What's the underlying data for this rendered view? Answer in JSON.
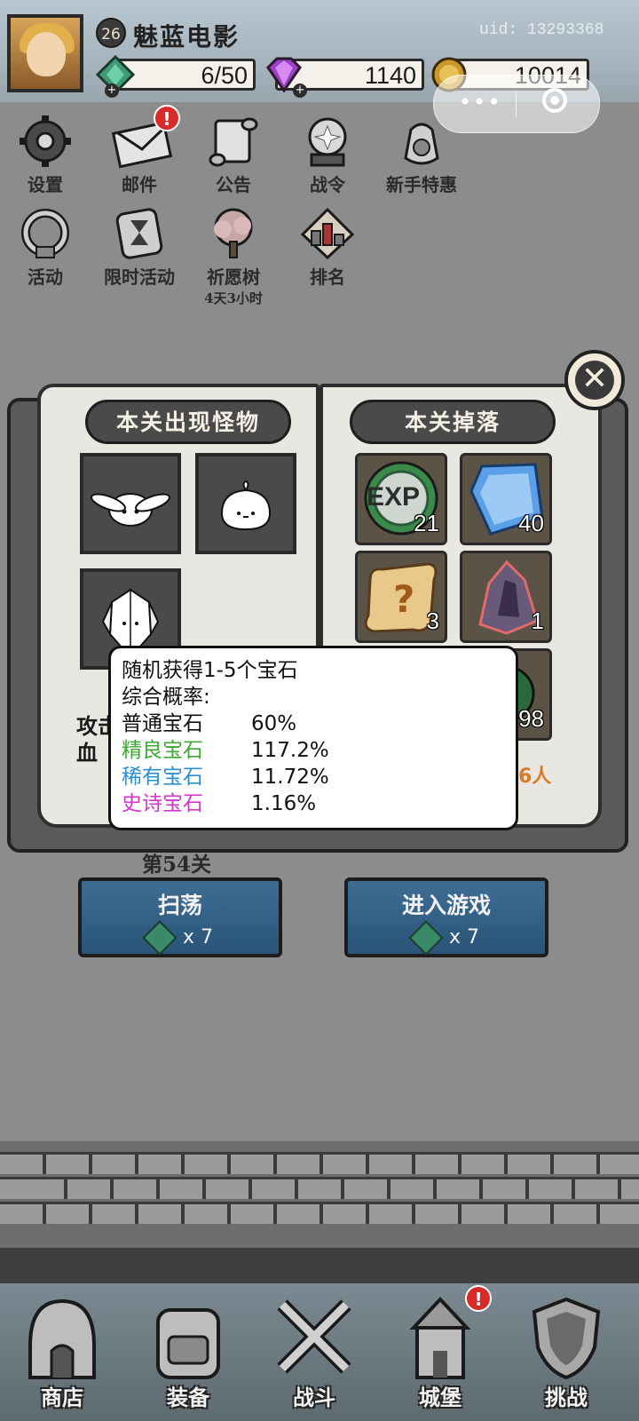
{
  "player": {
    "level": "26",
    "name": "魅蓝电影",
    "uid": "uid: 13293368"
  },
  "resources": {
    "stamina": "6/50",
    "diamonds": "1140",
    "coins": "10014"
  },
  "menu": [
    {
      "label": "设置",
      "icon": "gear-icon"
    },
    {
      "label": "邮件",
      "icon": "mail-icon",
      "badge": "!"
    },
    {
      "label": "公告",
      "icon": "scroll-icon"
    },
    {
      "label": "战令",
      "icon": "crystal-ball-icon"
    },
    {
      "label": "新手特惠",
      "icon": "money-bag-icon"
    },
    {
      "label": "活动",
      "icon": "wreath-icon"
    },
    {
      "label": "限时活动",
      "icon": "hourglass-icon"
    },
    {
      "label": "祈愿树",
      "icon": "tree-icon",
      "sub": "4天3小时"
    },
    {
      "label": "排名",
      "icon": "ranking-board-icon"
    }
  ],
  "modal": {
    "monsters_title": "本关出现怪物",
    "drops_title": "本关掉落",
    "monsters": [
      "rabbit-monster-icon",
      "dumpling-monster-icon",
      "crystal-golem-icon"
    ],
    "drops": [
      {
        "icon": "exp-icon",
        "exp_label": "EXP",
        "count": "21"
      },
      {
        "icon": "blue-gem-icon",
        "count": "40"
      },
      {
        "icon": "mystery-scroll-icon",
        "count": "3"
      },
      {
        "icon": "dark-crystal-icon",
        "count": "1"
      },
      {
        "icon": "green-orb-icon",
        "count": "98"
      }
    ],
    "stat_attack": "攻击",
    "stat_hp": "血",
    "players_suffix": "6人"
  },
  "tooltip": {
    "line1": "随机获得1-5个宝石",
    "line2": "综合概率:",
    "rows": [
      {
        "name": "普通宝石",
        "pct": "60%",
        "color": "#111111"
      },
      {
        "name": "精良宝石",
        "pct": "117.2%",
        "color": "#3fa835"
      },
      {
        "name": "稀有宝石",
        "pct": "11.72%",
        "color": "#2a8fd4"
      },
      {
        "name": "史诗宝石",
        "pct": "1.16%",
        "color": "#d436c8"
      }
    ]
  },
  "stage": {
    "label": "第54关",
    "sweep": {
      "label": "扫荡",
      "cost": "x 7"
    },
    "enter": {
      "label": "进入游戏",
      "cost": "x 7"
    }
  },
  "nav": [
    {
      "label": "商店",
      "icon": "shop-icon"
    },
    {
      "label": "装备",
      "icon": "backpack-icon"
    },
    {
      "label": "战斗",
      "icon": "crossed-swords-icon"
    },
    {
      "label": "城堡",
      "icon": "castle-icon",
      "badge": "!"
    },
    {
      "label": "挑战",
      "icon": "shield-icon"
    }
  ]
}
